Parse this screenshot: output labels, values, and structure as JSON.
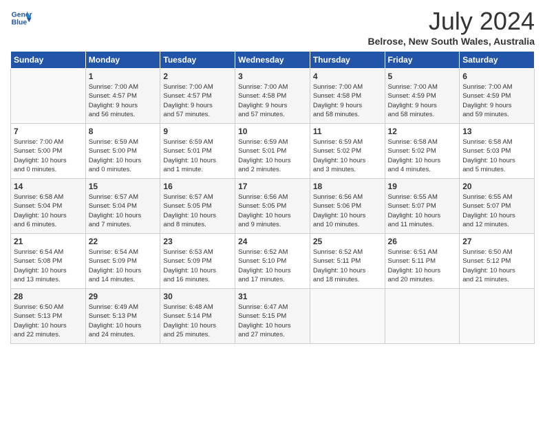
{
  "header": {
    "logo_line1": "General",
    "logo_line2": "Blue",
    "month_title": "July 2024",
    "location": "Belrose, New South Wales, Australia"
  },
  "days_of_week": [
    "Sunday",
    "Monday",
    "Tuesday",
    "Wednesday",
    "Thursday",
    "Friday",
    "Saturday"
  ],
  "weeks": [
    [
      {
        "day": "",
        "info": ""
      },
      {
        "day": "1",
        "info": "Sunrise: 7:00 AM\nSunset: 4:57 PM\nDaylight: 9 hours\nand 56 minutes."
      },
      {
        "day": "2",
        "info": "Sunrise: 7:00 AM\nSunset: 4:57 PM\nDaylight: 9 hours\nand 57 minutes."
      },
      {
        "day": "3",
        "info": "Sunrise: 7:00 AM\nSunset: 4:58 PM\nDaylight: 9 hours\nand 57 minutes."
      },
      {
        "day": "4",
        "info": "Sunrise: 7:00 AM\nSunset: 4:58 PM\nDaylight: 9 hours\nand 58 minutes."
      },
      {
        "day": "5",
        "info": "Sunrise: 7:00 AM\nSunset: 4:59 PM\nDaylight: 9 hours\nand 58 minutes."
      },
      {
        "day": "6",
        "info": "Sunrise: 7:00 AM\nSunset: 4:59 PM\nDaylight: 9 hours\nand 59 minutes."
      }
    ],
    [
      {
        "day": "7",
        "info": "Sunrise: 7:00 AM\nSunset: 5:00 PM\nDaylight: 10 hours\nand 0 minutes."
      },
      {
        "day": "8",
        "info": "Sunrise: 6:59 AM\nSunset: 5:00 PM\nDaylight: 10 hours\nand 0 minutes."
      },
      {
        "day": "9",
        "info": "Sunrise: 6:59 AM\nSunset: 5:01 PM\nDaylight: 10 hours\nand 1 minute."
      },
      {
        "day": "10",
        "info": "Sunrise: 6:59 AM\nSunset: 5:01 PM\nDaylight: 10 hours\nand 2 minutes."
      },
      {
        "day": "11",
        "info": "Sunrise: 6:59 AM\nSunset: 5:02 PM\nDaylight: 10 hours\nand 3 minutes."
      },
      {
        "day": "12",
        "info": "Sunrise: 6:58 AM\nSunset: 5:02 PM\nDaylight: 10 hours\nand 4 minutes."
      },
      {
        "day": "13",
        "info": "Sunrise: 6:58 AM\nSunset: 5:03 PM\nDaylight: 10 hours\nand 5 minutes."
      }
    ],
    [
      {
        "day": "14",
        "info": "Sunrise: 6:58 AM\nSunset: 5:04 PM\nDaylight: 10 hours\nand 6 minutes."
      },
      {
        "day": "15",
        "info": "Sunrise: 6:57 AM\nSunset: 5:04 PM\nDaylight: 10 hours\nand 7 minutes."
      },
      {
        "day": "16",
        "info": "Sunrise: 6:57 AM\nSunset: 5:05 PM\nDaylight: 10 hours\nand 8 minutes."
      },
      {
        "day": "17",
        "info": "Sunrise: 6:56 AM\nSunset: 5:05 PM\nDaylight: 10 hours\nand 9 minutes."
      },
      {
        "day": "18",
        "info": "Sunrise: 6:56 AM\nSunset: 5:06 PM\nDaylight: 10 hours\nand 10 minutes."
      },
      {
        "day": "19",
        "info": "Sunrise: 6:55 AM\nSunset: 5:07 PM\nDaylight: 10 hours\nand 11 minutes."
      },
      {
        "day": "20",
        "info": "Sunrise: 6:55 AM\nSunset: 5:07 PM\nDaylight: 10 hours\nand 12 minutes."
      }
    ],
    [
      {
        "day": "21",
        "info": "Sunrise: 6:54 AM\nSunset: 5:08 PM\nDaylight: 10 hours\nand 13 minutes."
      },
      {
        "day": "22",
        "info": "Sunrise: 6:54 AM\nSunset: 5:09 PM\nDaylight: 10 hours\nand 14 minutes."
      },
      {
        "day": "23",
        "info": "Sunrise: 6:53 AM\nSunset: 5:09 PM\nDaylight: 10 hours\nand 16 minutes."
      },
      {
        "day": "24",
        "info": "Sunrise: 6:52 AM\nSunset: 5:10 PM\nDaylight: 10 hours\nand 17 minutes."
      },
      {
        "day": "25",
        "info": "Sunrise: 6:52 AM\nSunset: 5:11 PM\nDaylight: 10 hours\nand 18 minutes."
      },
      {
        "day": "26",
        "info": "Sunrise: 6:51 AM\nSunset: 5:11 PM\nDaylight: 10 hours\nand 20 minutes."
      },
      {
        "day": "27",
        "info": "Sunrise: 6:50 AM\nSunset: 5:12 PM\nDaylight: 10 hours\nand 21 minutes."
      }
    ],
    [
      {
        "day": "28",
        "info": "Sunrise: 6:50 AM\nSunset: 5:13 PM\nDaylight: 10 hours\nand 22 minutes."
      },
      {
        "day": "29",
        "info": "Sunrise: 6:49 AM\nSunset: 5:13 PM\nDaylight: 10 hours\nand 24 minutes."
      },
      {
        "day": "30",
        "info": "Sunrise: 6:48 AM\nSunset: 5:14 PM\nDaylight: 10 hours\nand 25 minutes."
      },
      {
        "day": "31",
        "info": "Sunrise: 6:47 AM\nSunset: 5:15 PM\nDaylight: 10 hours\nand 27 minutes."
      },
      {
        "day": "",
        "info": ""
      },
      {
        "day": "",
        "info": ""
      },
      {
        "day": "",
        "info": ""
      }
    ]
  ]
}
